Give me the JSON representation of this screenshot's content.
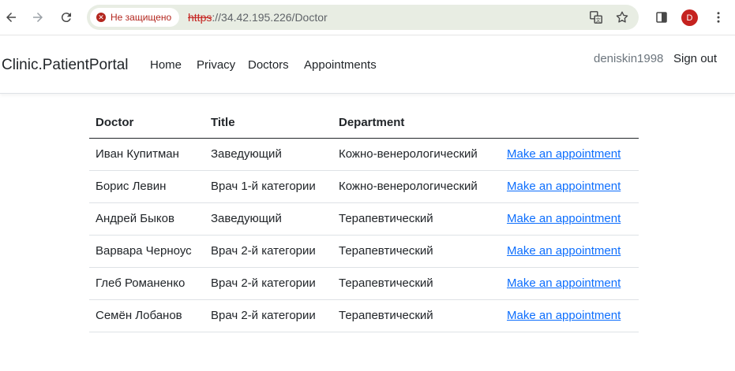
{
  "browser": {
    "security_label": "Не защищено",
    "url_scheme": "https",
    "url_rest": "://34.42.195.226/Doctor",
    "profile_initial": "D"
  },
  "navbar": {
    "brand": "Clinic.PatientPortal",
    "links": [
      "Home",
      "Privacy",
      "Doctors",
      "Appointments"
    ],
    "username": "deniskin1998",
    "signout": "Sign out"
  },
  "table": {
    "headers": [
      "Doctor",
      "Title",
      "Department",
      ""
    ],
    "rows": [
      {
        "doctor": "Иван Купитман",
        "title": "Заведующий",
        "department": "Кожно-венерологический",
        "action": "Make an appointment"
      },
      {
        "doctor": "Борис Левин",
        "title": "Врач 1-й категории",
        "department": "Кожно-венерологический",
        "action": "Make an appointment"
      },
      {
        "doctor": "Андрей Быков",
        "title": "Заведующий",
        "department": "Терапевтический",
        "action": "Make an appointment"
      },
      {
        "doctor": "Варвара Черноус",
        "title": "Врач 2-й категории",
        "department": "Терапевтический",
        "action": "Make an appointment"
      },
      {
        "doctor": "Глеб Романенко",
        "title": "Врач 2-й категории",
        "department": "Терапевтический",
        "action": "Make an appointment"
      },
      {
        "doctor": "Семён Лобанов",
        "title": "Врач 2-й категории",
        "department": "Терапевтический",
        "action": "Make an appointment"
      }
    ]
  },
  "colors": {
    "link": "#0d6efd",
    "insecure": "#c5221f",
    "omnibox": "#e8ede3"
  }
}
